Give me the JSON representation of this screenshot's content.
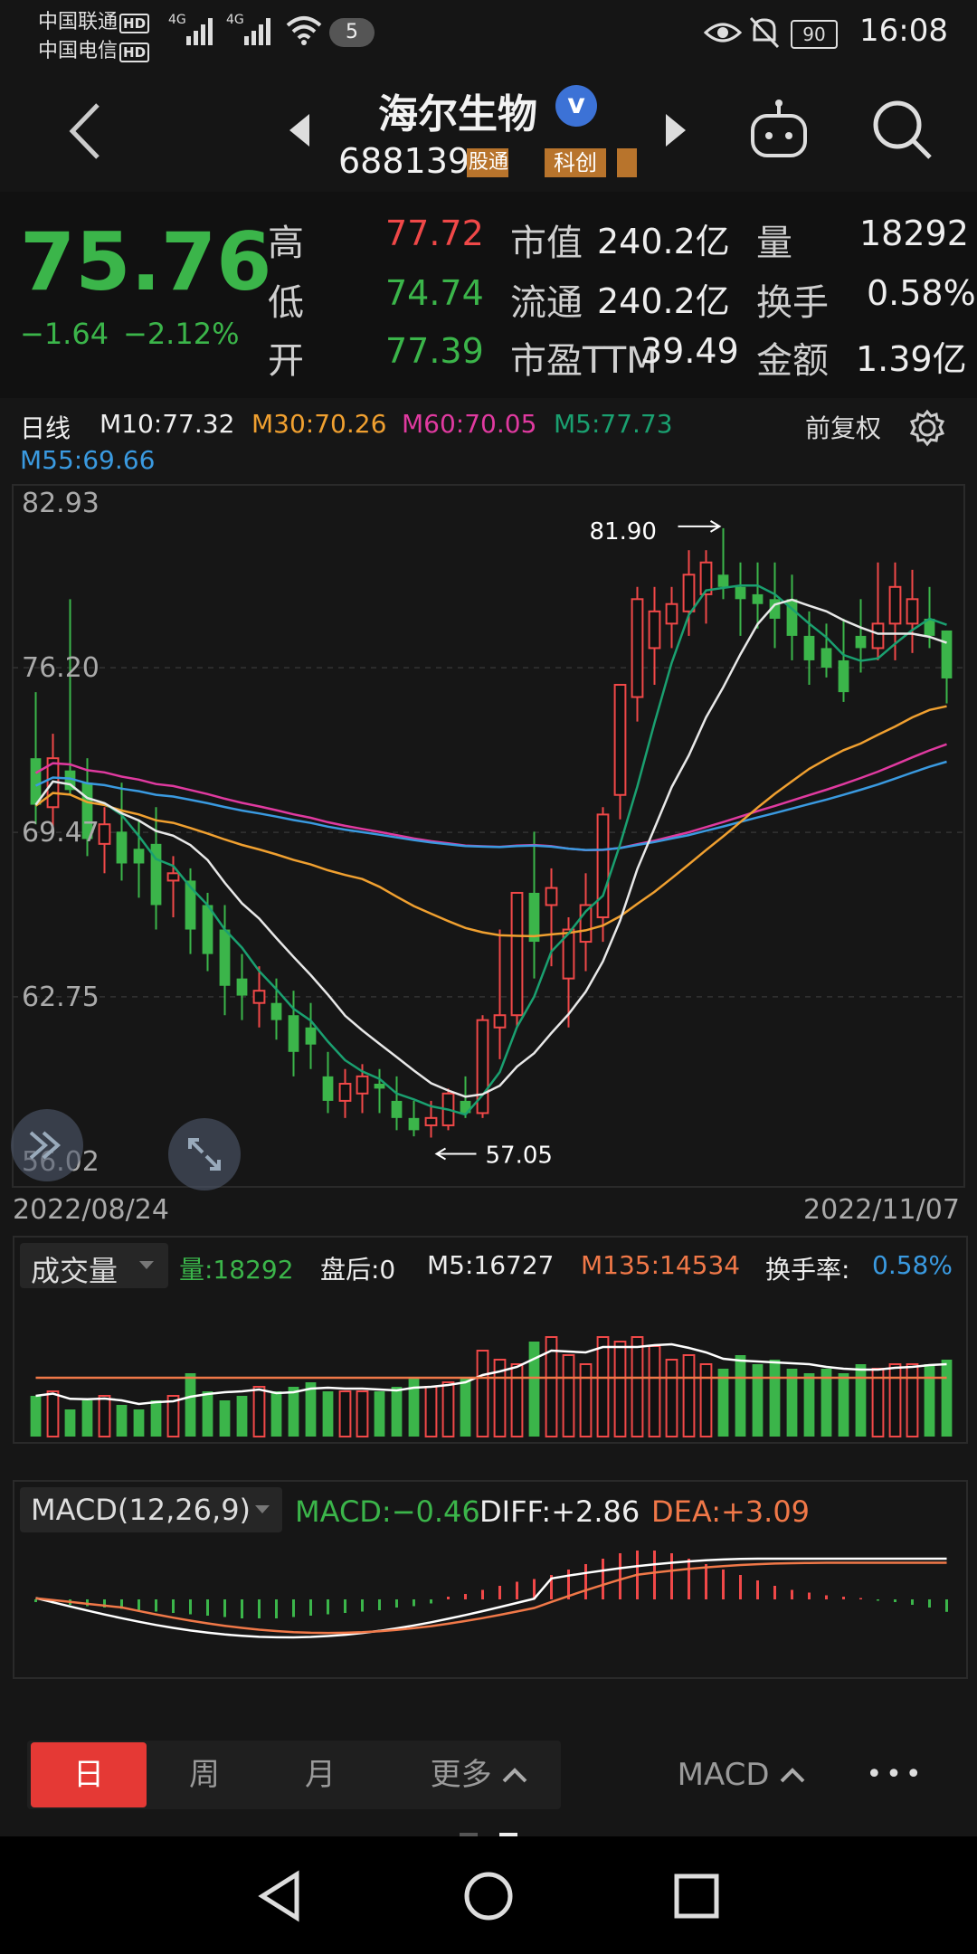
{
  "status": {
    "carrier1": "中国联通",
    "carrier2": "中国电信",
    "hd": "HD",
    "net1": "4G",
    "net2": "4G",
    "notif_count": "5",
    "battery": "90",
    "time": "16:08"
  },
  "nav": {
    "stock_name": "海尔生物",
    "verified_badge": "v",
    "stock_code": "688139",
    "tag_connect": "股通",
    "tag_board": "科创"
  },
  "quote": {
    "price": "75.76",
    "change": "−1.64",
    "change_pct": "−2.12%",
    "high_label": "高",
    "high": "77.72",
    "low_label": "低",
    "low": "74.74",
    "open_label": "开",
    "open": "77.39",
    "mktcap_label": "市值",
    "mktcap": "240.2亿",
    "float_label": "流通",
    "float": "240.2亿",
    "pe_label": "市盈TTM",
    "pe": "39.49",
    "vol_label": "量",
    "vol": "18292",
    "turnover_label": "换手",
    "turnover": "0.58%",
    "amount_label": "金额",
    "amount": "1.39亿"
  },
  "kline": {
    "period": "日线",
    "m10": "M10:77.32",
    "m30": "M30:70.26",
    "m60": "M60:70.05",
    "m5": "M5:77.73",
    "m55": "M55:69.66",
    "adjust": "前复权",
    "date_start": "2022/08/24",
    "date_end": "2022/11/07",
    "marker_high": "81.90",
    "marker_low": "57.05",
    "colors": {
      "m10": "#e8e8e8",
      "m30": "#f0a030",
      "m60": "#e03aa0",
      "m5": "#1aa070",
      "m55": "#3a9ae0",
      "up": "#f04848",
      "down": "#3bb54a"
    }
  },
  "chart_data": [
    {
      "type": "candlestick",
      "title": "日线",
      "xlabel": "",
      "ylabel": "",
      "x_range": [
        "2022/08/24",
        "2022/11/07"
      ],
      "y_ticks": [
        "82.93",
        "76.20",
        "69.47",
        "62.75",
        "56.02"
      ],
      "ylim": [
        56.02,
        82.93
      ],
      "candles": [
        {
          "o": 72.5,
          "h": 75.2,
          "l": 69.8,
          "c": 70.6
        },
        {
          "o": 70.5,
          "h": 73.5,
          "l": 69.5,
          "c": 72.5
        },
        {
          "o": 72.0,
          "h": 79.0,
          "l": 71.0,
          "c": 71.2
        },
        {
          "o": 71.5,
          "h": 72.5,
          "l": 68.5,
          "c": 69.2
        },
        {
          "o": 69.0,
          "h": 70.5,
          "l": 67.8,
          "c": 69.8
        },
        {
          "o": 69.5,
          "h": 71.5,
          "l": 67.5,
          "c": 68.2
        },
        {
          "o": 68.8,
          "h": 70.0,
          "l": 66.8,
          "c": 68.2
        },
        {
          "o": 69.0,
          "h": 70.5,
          "l": 65.5,
          "c": 66.5
        },
        {
          "o": 67.5,
          "h": 68.5,
          "l": 66.0,
          "c": 67.8
        },
        {
          "o": 67.5,
          "h": 68.0,
          "l": 64.5,
          "c": 65.5
        },
        {
          "o": 66.5,
          "h": 67.0,
          "l": 63.8,
          "c": 64.5
        },
        {
          "o": 65.5,
          "h": 66.5,
          "l": 62.0,
          "c": 63.2
        },
        {
          "o": 63.5,
          "h": 64.5,
          "l": 61.8,
          "c": 62.8
        },
        {
          "o": 62.5,
          "h": 64.0,
          "l": 61.5,
          "c": 63.0
        },
        {
          "o": 62.5,
          "h": 63.5,
          "l": 61.0,
          "c": 61.8
        },
        {
          "o": 62.0,
          "h": 63.0,
          "l": 59.5,
          "c": 60.5
        },
        {
          "o": 61.5,
          "h": 62.5,
          "l": 59.8,
          "c": 60.8
        },
        {
          "o": 59.5,
          "h": 60.5,
          "l": 58.0,
          "c": 58.5
        },
        {
          "o": 58.5,
          "h": 59.8,
          "l": 57.8,
          "c": 59.2
        },
        {
          "o": 58.8,
          "h": 60.0,
          "l": 58.0,
          "c": 59.5
        },
        {
          "o": 59.2,
          "h": 59.8,
          "l": 58.0,
          "c": 59.0
        },
        {
          "o": 58.5,
          "h": 59.5,
          "l": 57.3,
          "c": 57.8
        },
        {
          "o": 57.8,
          "h": 58.5,
          "l": 57.05,
          "c": 57.3
        },
        {
          "o": 57.5,
          "h": 58.5,
          "l": 57.0,
          "c": 57.8
        },
        {
          "o": 57.5,
          "h": 59.0,
          "l": 57.3,
          "c": 58.8
        },
        {
          "o": 58.5,
          "h": 59.5,
          "l": 57.8,
          "c": 58.0
        },
        {
          "o": 58.0,
          "h": 62.0,
          "l": 57.8,
          "c": 61.8
        },
        {
          "o": 61.5,
          "h": 65.5,
          "l": 60.2,
          "c": 62.0
        },
        {
          "o": 62.0,
          "h": 67.0,
          "l": 61.5,
          "c": 67.0
        },
        {
          "o": 67.0,
          "h": 69.5,
          "l": 63.5,
          "c": 65.0
        },
        {
          "o": 66.5,
          "h": 68.0,
          "l": 64.0,
          "c": 67.2
        },
        {
          "o": 63.5,
          "h": 66.0,
          "l": 61.5,
          "c": 65.5
        },
        {
          "o": 65.0,
          "h": 67.8,
          "l": 63.8,
          "c": 66.5
        },
        {
          "o": 66.0,
          "h": 70.5,
          "l": 65.0,
          "c": 70.2
        },
        {
          "o": 71.0,
          "h": 75.5,
          "l": 70.0,
          "c": 75.5
        },
        {
          "o": 75.0,
          "h": 79.5,
          "l": 74.0,
          "c": 79.0
        },
        {
          "o": 77.0,
          "h": 79.5,
          "l": 75.5,
          "c": 78.5
        },
        {
          "o": 78.0,
          "h": 79.5,
          "l": 77.0,
          "c": 78.8
        },
        {
          "o": 78.5,
          "h": 81.0,
          "l": 77.5,
          "c": 80.0
        },
        {
          "o": 79.2,
          "h": 81.0,
          "l": 78.0,
          "c": 80.5
        },
        {
          "o": 80.0,
          "h": 81.9,
          "l": 79.0,
          "c": 79.5
        },
        {
          "o": 79.5,
          "h": 80.5,
          "l": 77.5,
          "c": 79.0
        },
        {
          "o": 79.2,
          "h": 80.5,
          "l": 77.8,
          "c": 78.8
        },
        {
          "o": 79.0,
          "h": 80.5,
          "l": 77.0,
          "c": 78.2
        },
        {
          "o": 79.0,
          "h": 80.0,
          "l": 76.5,
          "c": 77.5
        },
        {
          "o": 77.5,
          "h": 78.5,
          "l": 75.5,
          "c": 76.5
        },
        {
          "o": 77.0,
          "h": 78.0,
          "l": 75.8,
          "c": 76.2
        },
        {
          "o": 76.5,
          "h": 78.2,
          "l": 74.8,
          "c": 75.2
        },
        {
          "o": 77.5,
          "h": 79.0,
          "l": 76.0,
          "c": 77.0
        },
        {
          "o": 77.0,
          "h": 80.5,
          "l": 76.5,
          "c": 78.0
        },
        {
          "o": 78.0,
          "h": 80.5,
          "l": 76.5,
          "c": 79.5
        },
        {
          "o": 78.0,
          "h": 80.2,
          "l": 76.8,
          "c": 79.0
        },
        {
          "o": 78.2,
          "h": 79.5,
          "l": 77.0,
          "c": 77.5
        },
        {
          "o": 77.72,
          "h": 77.72,
          "l": 74.74,
          "c": 75.76
        }
      ]
    },
    {
      "type": "bar",
      "title": "成交量",
      "values": [
        9,
        10,
        6,
        8,
        9,
        7,
        6,
        8,
        9,
        14,
        10,
        8,
        9,
        11,
        10,
        11,
        12,
        10,
        10,
        10,
        10,
        11,
        13,
        11,
        12,
        13,
        19,
        17,
        16,
        21,
        22,
        18,
        16,
        22,
        21,
        22,
        20,
        17,
        18,
        16,
        15,
        18,
        16,
        17,
        15,
        14,
        15,
        14,
        16,
        15,
        16,
        16,
        16,
        17
      ],
      "m5": "M5:16727",
      "m135": "M135:14534",
      "after_hours": "盘后:0",
      "turnover_rate": "0.58%"
    },
    {
      "type": "bar",
      "title": "MACD(12,26,9)",
      "macd": "MACD:−0.46",
      "diff": "DIFF:+2.86",
      "dea": "DEA:+3.09",
      "bars": [
        -0.1,
        -0.15,
        -0.2,
        -0.25,
        -0.3,
        -0.35,
        -0.4,
        -0.45,
        -0.5,
        -0.55,
        -0.6,
        -0.65,
        -0.7,
        -0.7,
        -0.7,
        -0.65,
        -0.6,
        -0.55,
        -0.5,
        -0.45,
        -0.4,
        -0.3,
        -0.25,
        -0.15,
        0.1,
        0.2,
        0.35,
        0.5,
        0.65,
        0.75,
        0.9,
        1.1,
        1.3,
        1.5,
        1.7,
        1.8,
        1.8,
        1.7,
        1.5,
        1.3,
        1.1,
        0.9,
        0.7,
        0.5,
        0.35,
        0.25,
        0.15,
        0.1,
        0.05,
        -0.05,
        -0.1,
        -0.2,
        -0.3,
        -0.46
      ]
    }
  ],
  "volume_panel": {
    "selector": "成交量",
    "vol": "量:18292",
    "after": "盘后:0",
    "m5": "M5:16727",
    "m135": "M135:14534",
    "turnover_label": "换手率:",
    "turnover": "0.58%"
  },
  "macd_panel": {
    "selector": "MACD(12,26,9)",
    "macd": "MACD:−0.46",
    "diff": "DIFF:+2.86",
    "dea": "DEA:+3.09"
  },
  "tabs": {
    "day": "日",
    "week": "周",
    "month": "月",
    "more": "更多",
    "indicator": "MACD",
    "more_dots": "•••"
  }
}
